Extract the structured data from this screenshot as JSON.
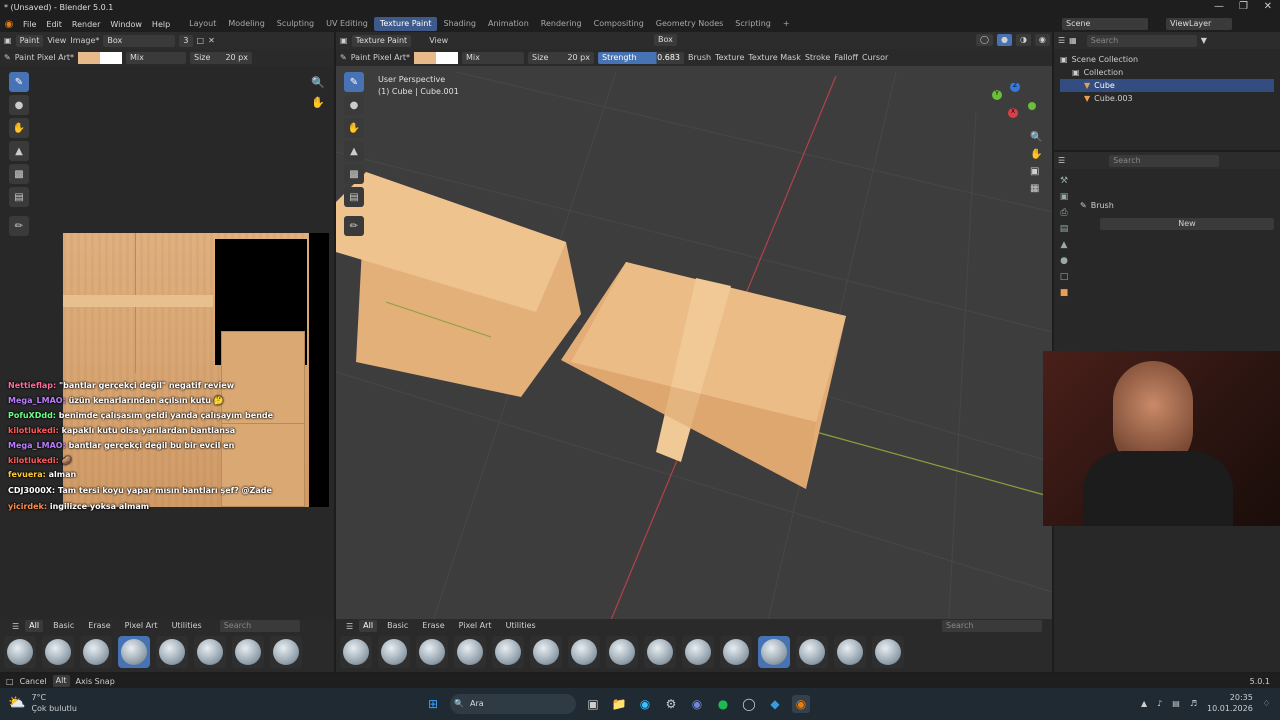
{
  "window": {
    "title": "* (Unsaved) - Blender 5.0.1"
  },
  "menus": [
    "File",
    "Edit",
    "Render",
    "Window",
    "Help"
  ],
  "workspaces": [
    {
      "label": "Layout"
    },
    {
      "label": "Modeling"
    },
    {
      "label": "Sculpting"
    },
    {
      "label": "UV Editing"
    },
    {
      "label": "Texture Paint",
      "active": true
    },
    {
      "label": "Shading"
    },
    {
      "label": "Animation"
    },
    {
      "label": "Rendering"
    },
    {
      "label": "Compositing"
    },
    {
      "label": "Geometry Nodes"
    },
    {
      "label": "Scripting"
    }
  ],
  "scene": {
    "name": "Scene",
    "viewlayer": "ViewLayer"
  },
  "image_editor": {
    "header": {
      "mode": "Paint",
      "view": "View",
      "image": "Image*",
      "image_name": "Box",
      "users": "3"
    },
    "tool_header": {
      "brush": "Paint Pixel Art*",
      "blend": "Mix",
      "size_label": "Size",
      "size_value": "20 px"
    },
    "asset_tabs": [
      "All",
      "Basic",
      "Erase",
      "Pixel Art",
      "Utilities"
    ],
    "search_placeholder": "Search"
  },
  "viewport": {
    "header": {
      "mode": "Texture Paint",
      "view": "View",
      "select_box": "Box"
    },
    "tool_header": {
      "brush": "Paint Pixel Art*",
      "blend": "Mix",
      "size_label": "Size",
      "size_value": "20 px",
      "strength_label": "Strength",
      "strength_value": "0.683",
      "menus": [
        "Brush",
        "Texture",
        "Texture Mask",
        "Stroke",
        "Falloff",
        "Cursor"
      ]
    },
    "overlay_title": "User Perspective",
    "overlay_object": "(1) Cube | Cube.001",
    "asset_tabs": [
      "All",
      "Basic",
      "Erase",
      "Pixel Art",
      "Utilities"
    ],
    "search_placeholder": "Search",
    "gizmo": {
      "x": "X",
      "y": "Y",
      "z": "Z"
    }
  },
  "outliner": {
    "search_placeholder": "Search",
    "root": "Scene Collection",
    "collection": "Collection",
    "items": [
      {
        "name": "Cube",
        "selected": true
      },
      {
        "name": "Cube.003",
        "selected": false
      }
    ]
  },
  "properties": {
    "search_placeholder": "Search",
    "panel_title": "Brush",
    "new_label": "New"
  },
  "chat": [
    {
      "user": "Nettieflap:",
      "text": "\"bantlar gerçekçi değil\" negatif review",
      "color": "#ff6b9d"
    },
    {
      "user": "Mega_LMAO:",
      "text": "üzün kenarlarından açılsın kutu 🤔",
      "color": "#b97cff"
    },
    {
      "user": "PofuXDdd:",
      "text": "benimde çalışasım geldi yanda çalışayım bende",
      "color": "#6bff8a"
    },
    {
      "user": "kilotlukedi:",
      "text": "kapaklı kutu olsa yarılardan bantlansa",
      "color": "#ff5a5a"
    },
    {
      "user": "Mega_LMAO:",
      "text": "bantlar gerçekçi değil bu bir evcil en",
      "color": "#b97cff"
    },
    {
      "user": "kilotlukedi:",
      "text": "🥔",
      "color": "#ff5a5a"
    },
    {
      "user": "fevuera:",
      "text": "alman",
      "color": "#ffcc33"
    },
    {
      "user": "CDJ3000X:",
      "text": "Tam tersi koyu yapar mısın bantları şef? @Zade",
      "color": "#ffffff"
    },
    {
      "user": "yicirdek:",
      "text": "ingilizce yoksa almam",
      "color": "#ff8a4b"
    }
  ],
  "statusbar": {
    "cancel": "Cancel",
    "axis_snap": "Axis Snap",
    "version": "5.0.1"
  },
  "taskbar": {
    "weather_temp": "7°C",
    "weather_desc": "Çok bulutlu",
    "search": "Ara",
    "time": "20:35",
    "date": "10.01.2026"
  },
  "colors": {
    "accent": "#4772b3",
    "cardboard": "#e3b07a",
    "primary_color": "#e8b98a"
  }
}
